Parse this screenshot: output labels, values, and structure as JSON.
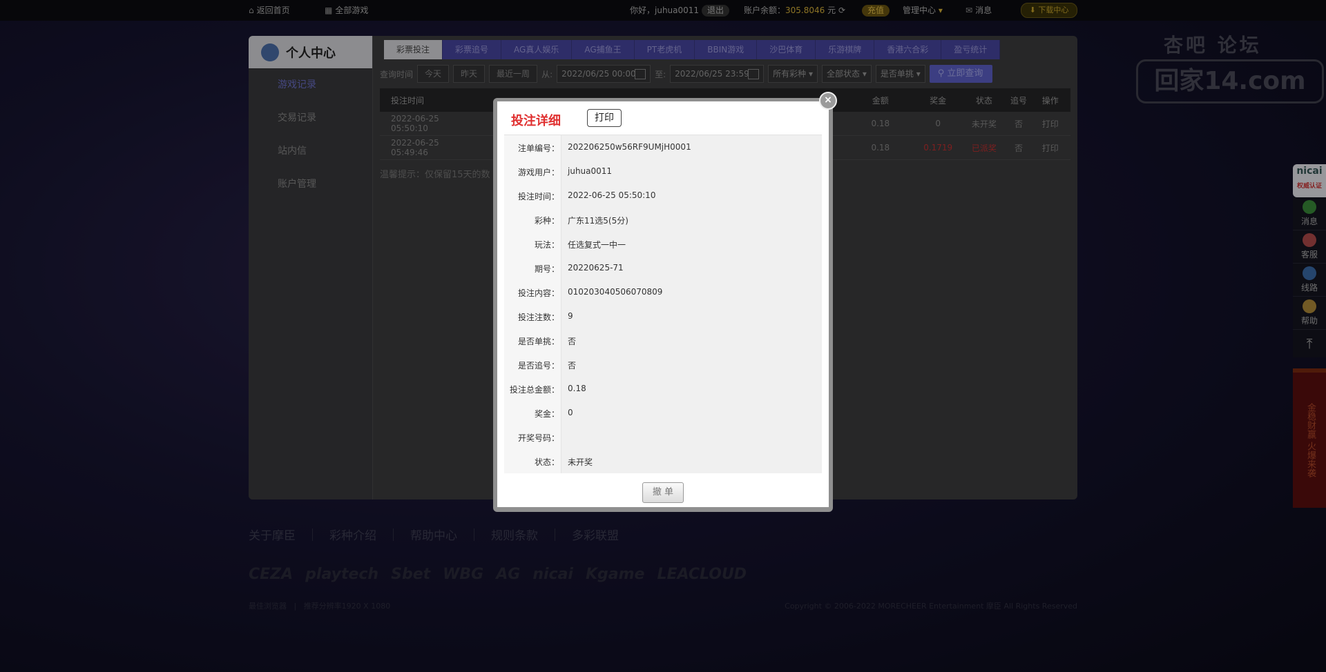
{
  "topbar": {
    "home": "返回首页",
    "all_games": "全部游戏",
    "greeting": "你好，juhua0011",
    "logout": "退出",
    "balance_label": "账户余额：",
    "balance_value": "305.8046",
    "currency": "元",
    "recharge": "充值",
    "manage_center": "管理中心",
    "messages": "消息",
    "download": "下载中心"
  },
  "sidebar": {
    "title": "个人中心",
    "items": [
      {
        "label": "游戏记录"
      },
      {
        "label": "交易记录"
      },
      {
        "label": "站内信"
      },
      {
        "label": "账户管理"
      }
    ]
  },
  "tabs": [
    {
      "label": "彩票投注"
    },
    {
      "label": "彩票追号"
    },
    {
      "label": "AG真人娱乐"
    },
    {
      "label": "AG捕鱼王"
    },
    {
      "label": "PT老虎机"
    },
    {
      "label": "BBIN游戏"
    },
    {
      "label": "沙巴体育"
    },
    {
      "label": "乐游棋牌"
    },
    {
      "label": "香港六合彩"
    },
    {
      "label": "盈亏统计"
    }
  ],
  "filter": {
    "query_time": "查询时间",
    "today": "今天",
    "yesterday": "昨天",
    "last_week": "最近一周",
    "from": "从:",
    "from_date": "2022/06/25 00:00",
    "to": "至:",
    "to_date": "2022/06/25 23:59",
    "lottery_select": "所有彩种",
    "status_select": "全部状态",
    "single_select": "是否单挑",
    "search": "立即查询"
  },
  "table": {
    "headers": [
      "投注时间",
      "金额",
      "奖金",
      "状态",
      "追号",
      "操作"
    ],
    "rows": [
      {
        "time": "2022-06-25 05:50:10",
        "amount": "0.18",
        "prize": "0",
        "status": "未开奖",
        "chase": "否",
        "op": "打印"
      },
      {
        "time": "2022-06-25 05:49:46",
        "amount": "0.18",
        "prize": "0.1719",
        "status": "已派奖",
        "chase": "否",
        "op": "打印"
      }
    ],
    "tip": "温馨提示：仅保留15天的数"
  },
  "footer": {
    "links": [
      "关于摩臣",
      "彩种介绍",
      "帮助中心",
      "规则条款",
      "多彩联盟"
    ],
    "logos": [
      "CEZA",
      "playtech",
      "Sbet",
      "WBG",
      "AG",
      "nicai",
      "Kgame",
      "LEACLOUD"
    ],
    "left_text": "最佳浏览器",
    "resolution": "推荐分辨率1920 X 1080",
    "copyright": "Copyright © 2006-2022 MORECHEER Entertainment 摩臣 All Rights Reserved"
  },
  "watermark": {
    "line1": "杏吧 论坛",
    "line2": "回家14.com"
  },
  "right_float": {
    "logo": "nicai",
    "logo_sub": "权威认证",
    "items": [
      {
        "label": "消息"
      },
      {
        "label": "客服"
      },
      {
        "label": "线路"
      },
      {
        "label": "帮助"
      }
    ],
    "banner": "金稳财赢 火爆来袭"
  },
  "modal": {
    "title": "投注详细",
    "print": "打印",
    "close": "×",
    "fields": [
      {
        "label": "注单编号：",
        "value": "202206250w56RF9UMjH0001"
      },
      {
        "label": "游戏用户：",
        "value": "juhua0011"
      },
      {
        "label": "投注时间：",
        "value": "2022-06-25 05:50:10"
      },
      {
        "label": "彩种：",
        "value": "广东11选5(5分)"
      },
      {
        "label": "玩法：",
        "value": "任选复式一中一"
      },
      {
        "label": "期号：",
        "value": "20220625-71"
      },
      {
        "label": "投注内容：",
        "value": "010203040506070809"
      },
      {
        "label": "投注注数：",
        "value": "9"
      },
      {
        "label": "是否单挑：",
        "value": "否"
      },
      {
        "label": "是否追号：",
        "value": "否"
      },
      {
        "label": "投注总金额：",
        "value": "0.18"
      },
      {
        "label": "奖金：",
        "value": "0"
      },
      {
        "label": "开奖号码：",
        "value": ""
      },
      {
        "label": "状态：",
        "value": "未开奖"
      }
    ],
    "cancel": "撤 单"
  }
}
